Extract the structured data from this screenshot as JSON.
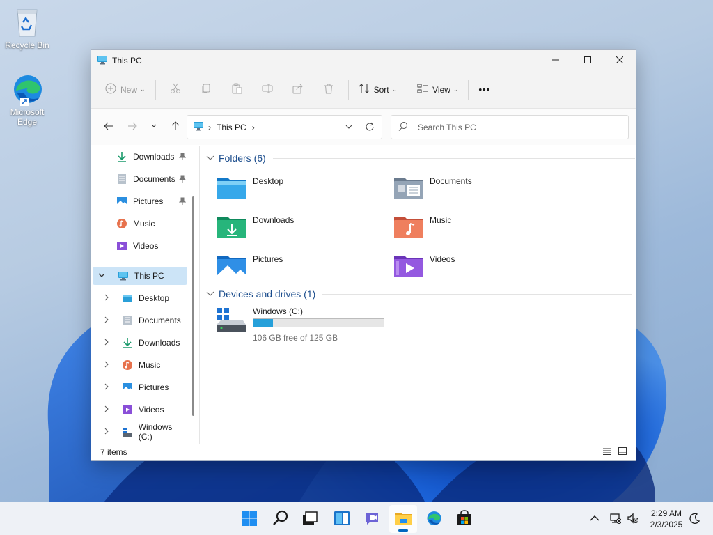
{
  "desktop": {
    "icons": [
      {
        "label": "Recycle Bin",
        "icon": "recycle-bin-icon"
      },
      {
        "label": "Microsoft Edge",
        "icon": "edge-icon"
      }
    ]
  },
  "window": {
    "title": "This PC",
    "controls": {
      "minimize": "minimize-icon",
      "maximize": "maximize-icon",
      "close": "close-icon"
    }
  },
  "toolbar": {
    "new_label": "New",
    "sort_label": "Sort",
    "view_label": "View",
    "more_label": "•••"
  },
  "address": {
    "path_root": "This PC",
    "separator_1": "›",
    "separator_2": "›",
    "search_placeholder": "Search This PC"
  },
  "navpane": {
    "quick_access": [
      {
        "label": "Downloads",
        "icon": "downloads-icon",
        "pinned": true
      },
      {
        "label": "Documents",
        "icon": "documents-icon",
        "pinned": true
      },
      {
        "label": "Pictures",
        "icon": "pictures-icon",
        "pinned": true
      },
      {
        "label": "Music",
        "icon": "music-icon",
        "pinned": false
      },
      {
        "label": "Videos",
        "icon": "videos-icon",
        "pinned": false
      }
    ],
    "this_pc": {
      "label": "This PC",
      "icon": "computer-icon"
    },
    "this_pc_children": [
      {
        "label": "Desktop",
        "icon": "desktop-folder-icon"
      },
      {
        "label": "Documents",
        "icon": "documents-icon"
      },
      {
        "label": "Downloads",
        "icon": "downloads-icon"
      },
      {
        "label": "Music",
        "icon": "music-icon"
      },
      {
        "label": "Pictures",
        "icon": "pictures-icon"
      },
      {
        "label": "Videos",
        "icon": "videos-icon"
      },
      {
        "label": "Windows (C:)",
        "icon": "drive-icon"
      }
    ]
  },
  "content": {
    "folders_header": "Folders (6)",
    "folders": [
      {
        "name": "Desktop",
        "icon": "desktop-folder-icon"
      },
      {
        "name": "Documents",
        "icon": "documents-folder-icon"
      },
      {
        "name": "Downloads",
        "icon": "downloads-folder-icon"
      },
      {
        "name": "Music",
        "icon": "music-folder-icon"
      },
      {
        "name": "Pictures",
        "icon": "pictures-folder-icon"
      },
      {
        "name": "Videos",
        "icon": "videos-folder-icon"
      }
    ],
    "drives_header": "Devices and drives (1)",
    "drive": {
      "name": "Windows (C:)",
      "usage_fraction": 0.152,
      "free_text": "106 GB free of 125 GB"
    }
  },
  "statusbar": {
    "items_text": "7 items"
  },
  "taskbar": {
    "apps": [
      {
        "name": "Start",
        "icon": "windows-start-icon"
      },
      {
        "name": "Search",
        "icon": "search-icon"
      },
      {
        "name": "Task View",
        "icon": "task-view-icon"
      },
      {
        "name": "Widgets",
        "icon": "widgets-icon"
      },
      {
        "name": "Chat",
        "icon": "chat-icon"
      },
      {
        "name": "File Explorer",
        "icon": "file-explorer-icon",
        "active": true
      },
      {
        "name": "Microsoft Edge",
        "icon": "edge-icon"
      },
      {
        "name": "Microsoft Store",
        "icon": "store-icon"
      }
    ],
    "time": "2:29 AM",
    "date": "2/3/2025"
  },
  "colors": {
    "accent": "#0067c0",
    "drive_bar": "#26a0da",
    "selected_nav": "#cce4f7",
    "group_header": "#1a4c8c"
  }
}
